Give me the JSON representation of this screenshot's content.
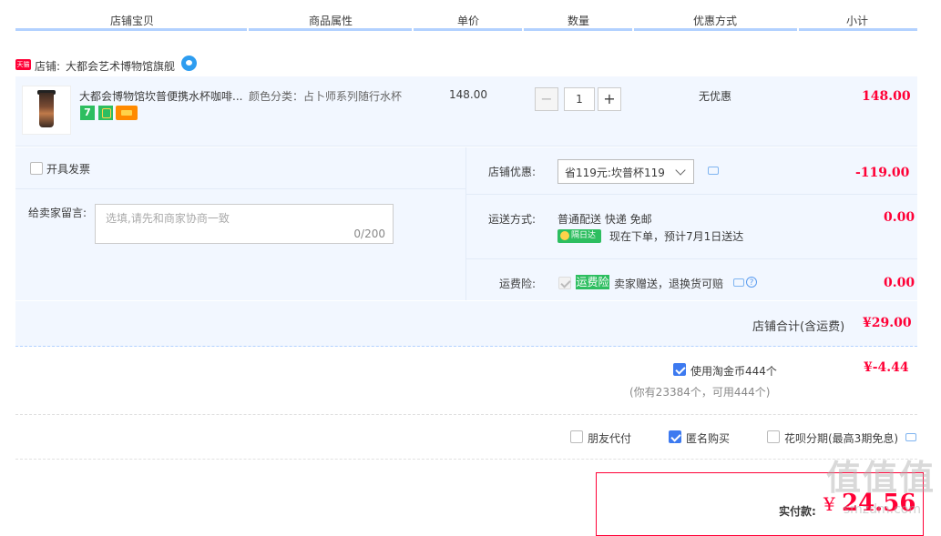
{
  "headers": [
    "店铺宝贝",
    "商品属性",
    "单价",
    "数量",
    "优惠方式",
    "小计"
  ],
  "shop": {
    "badge": "天猫",
    "label": "店铺:",
    "name": "大都会艺术博物馆旗舰"
  },
  "item": {
    "title": "大都会博物馆坎普便携水杯咖啡...",
    "attribute": "颜色分类：占卜师系列随行水杯",
    "unit_price": "148.00",
    "quantity": "1",
    "discount": "无优惠",
    "subtotal": "148.00",
    "tag_seven": "7",
    "qty_minus": "−",
    "qty_plus": "+"
  },
  "invoice": {
    "label": "开具发票"
  },
  "memo": {
    "label": "给卖家留言:",
    "placeholder": "选填,请先和商家协商一致",
    "counter": "0/200"
  },
  "shop_discount": {
    "label": "店铺优惠:",
    "selected": "省119元:坎普杯119",
    "amount": "-119.00"
  },
  "delivery": {
    "label": "运送方式:",
    "method": "普通配送 快递 免邮",
    "badge": "隔日达",
    "eta": "现在下单，预计7月1日送达",
    "amount": "0.00"
  },
  "freight_insurance": {
    "label": "运费险:",
    "tag": "运费险",
    "desc": "卖家赠送，退换货可赔",
    "help": "?",
    "amount": "0.00"
  },
  "shop_total": {
    "label": "店铺合计(含运费)",
    "amount": "¥29.00"
  },
  "coins": {
    "label": "使用淘金币444个",
    "note": "(你有23384个，可用444个)",
    "amount": "¥-4.44"
  },
  "options": {
    "friend_pay": "朋友代付",
    "anonymous": "匿名购买",
    "huabei": "花呗分期(最高3期免息)"
  },
  "pay": {
    "label": "实付款:",
    "currency": "¥",
    "amount": "24.56"
  },
  "watermark": {
    "big": "值值值",
    "site": "smzdm.com"
  },
  "colors": {
    "accent_red": "#ff0036",
    "light_blue_bg": "#f2f7ff",
    "header_line": "#b2d1ff",
    "check_blue": "#3d7af0",
    "tag_green": "#2dbe60"
  }
}
